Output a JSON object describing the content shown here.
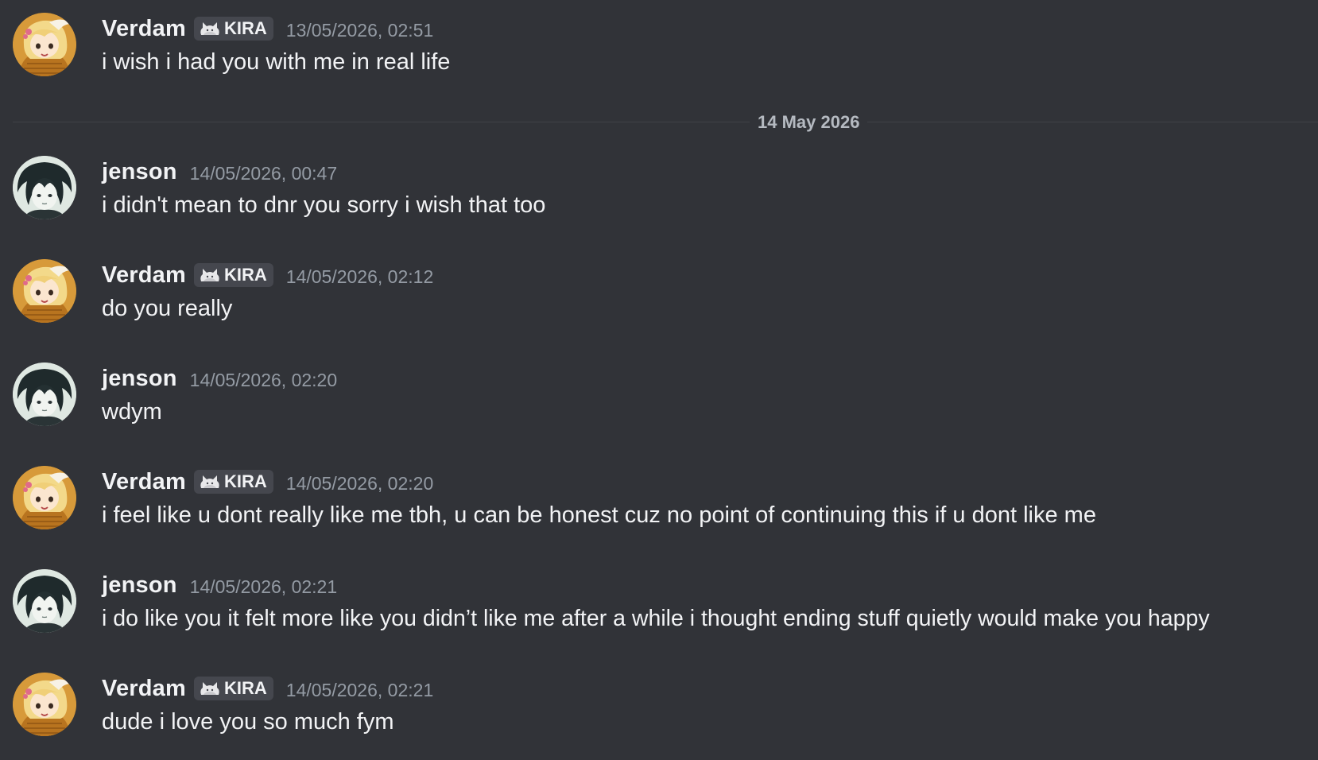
{
  "date_divider": {
    "label": "14 May 2026"
  },
  "tag_icon": "cat-ear-cloud-icon",
  "colors": {
    "background": "#313338",
    "text": "#f2f3f5",
    "timestamp": "#949ba4",
    "tag_background": "#45474e"
  },
  "messages": [
    {
      "author": "Verdam",
      "tag": "KIRA",
      "timestamp": "13/05/2026, 02:51",
      "text": "i wish i had you with me in real life"
    },
    {
      "author": "jenson",
      "tag": "",
      "timestamp": "14/05/2026, 00:47",
      "text": "i didn't mean to dnr you sorry i wish that too"
    },
    {
      "author": "Verdam",
      "tag": "KIRA",
      "timestamp": "14/05/2026, 02:12",
      "text": "do you really"
    },
    {
      "author": "jenson",
      "tag": "",
      "timestamp": "14/05/2026, 02:20",
      "text": "wdym"
    },
    {
      "author": "Verdam",
      "tag": "KIRA",
      "timestamp": "14/05/2026, 02:20",
      "text": "i feel like u dont really like me tbh, u can be honest cuz no point of continuing this if u dont like me"
    },
    {
      "author": "jenson",
      "tag": "",
      "timestamp": "14/05/2026, 02:21",
      "text": "i do like you it felt more like you didn’t like me after a while i thought ending stuff quietly would make you happy"
    },
    {
      "author": "Verdam",
      "tag": "KIRA",
      "timestamp": "14/05/2026, 02:21",
      "text": "dude i love you so much fym"
    }
  ]
}
